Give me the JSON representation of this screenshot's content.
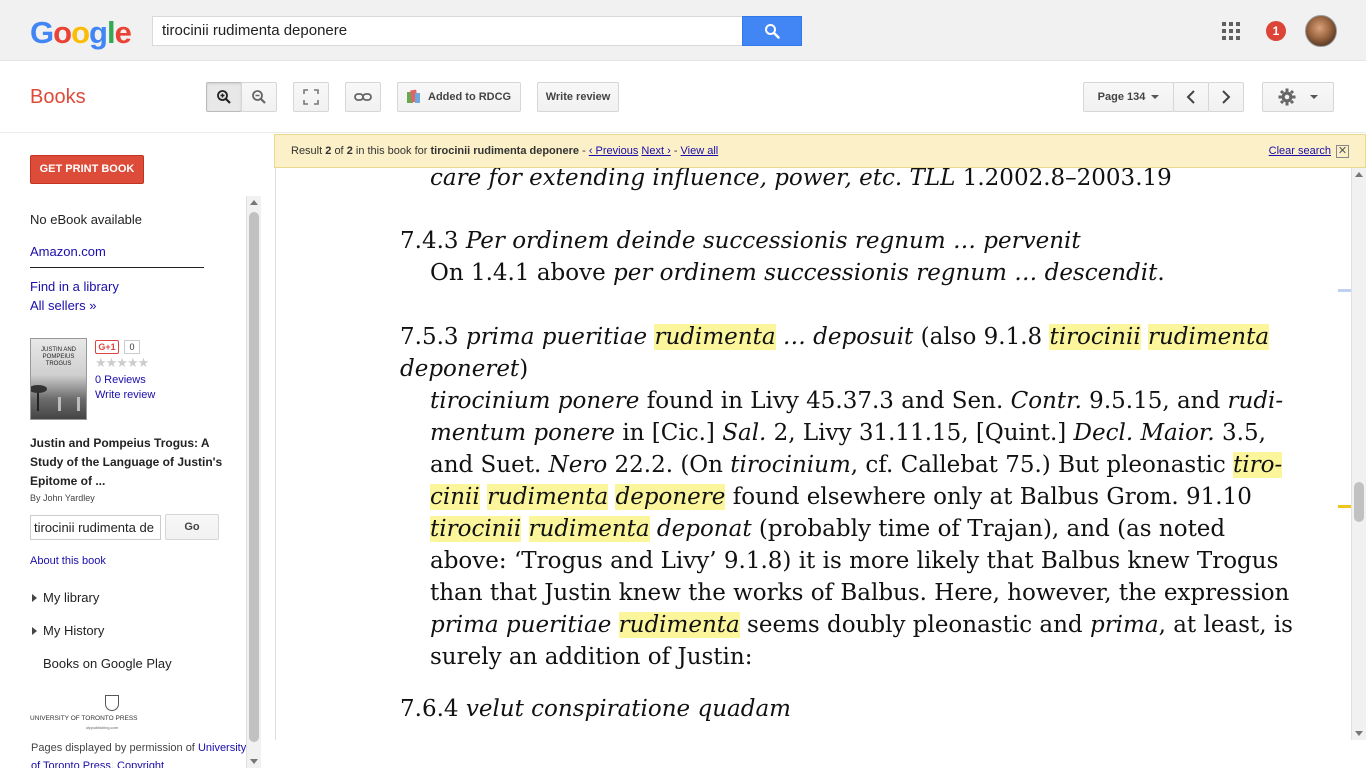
{
  "header": {
    "logo_letters": [
      {
        "ch": "G",
        "color": "#4285f4"
      },
      {
        "ch": "o",
        "color": "#ea4335"
      },
      {
        "ch": "o",
        "color": "#fbbc05"
      },
      {
        "ch": "g",
        "color": "#4285f4"
      },
      {
        "ch": "l",
        "color": "#34a853"
      },
      {
        "ch": "e",
        "color": "#ea4335"
      }
    ],
    "search_value": "tirocinii rudimenta deponere",
    "notification_count": "1"
  },
  "toolbar": {
    "section_title": "Books",
    "added_label": "Added to RDCG",
    "write_review_label": "Write review",
    "page_label": "Page 134"
  },
  "resultbar": {
    "result_prefix": "Result",
    "result_index": "2",
    "of_label": "of",
    "result_total": "2",
    "in_book_text": "in this book for",
    "query": "tirocinii rudimenta deponere",
    "previous_label": "‹ Previous",
    "next_label": "Next ›",
    "view_all_label": "View all",
    "clear_search_label": "Clear search"
  },
  "sidebar": {
    "print_button": "GET PRINT BOOK",
    "no_ebook": "No eBook available",
    "amazon": "Amazon.com",
    "find_library": "Find in a library",
    "all_sellers": "All sellers »",
    "cover_title": "JUSTIN AND POMPEIUS TROGUS",
    "gplus_label": "G+1",
    "gplus_count": "0",
    "reviews_label": "0 Reviews",
    "write_review_label": "Write review",
    "book_title": "Justin and Pompeius Trogus: A Study of the Language of Justin's Epitome of ...",
    "author": "By John Yardley",
    "search_value": "tirocinii rudimenta de",
    "go_label": "Go",
    "about_book": "About this book",
    "my_library": "My library",
    "my_history": "My History",
    "books_on_play": "Books on Google Play",
    "publisher_logo_name": "UNIVERSITY OF TORONTO PRESS",
    "publisher_logo_sub": "utppublishing.com",
    "permission_prefix": "Pages displayed by permission of",
    "permission_link": "University of Toronto Press",
    "copyright_label": "Copyright"
  },
  "page": {
    "lines": [
      {
        "parts": [
          {
            "t": "care for extending influence, power, etc. ",
            "i": true
          },
          {
            "t": "TLL",
            "i": true
          },
          {
            "t": " 1.2002.8–2003.19"
          }
        ]
      },
      {
        "parts": [
          {
            "t": "7.4.3 "
          },
          {
            "t": "Per ordinem deinde successionis regnum … pervenit",
            "i": true
          }
        ]
      },
      {
        "parts": [
          {
            "t": "On 1.4.1 above "
          },
          {
            "t": "per ordinem successionis regnum … descendit",
            "i": true
          },
          {
            "t": "."
          }
        ]
      },
      {
        "parts": [
          {
            "t": "7.5.3 "
          },
          {
            "t": "prima pueritiae ",
            "i": true
          },
          {
            "t": "rudimenta",
            "i": true,
            "h": true
          },
          {
            "t": " … deposuit",
            "i": true
          },
          {
            "t": " (also 9.1.8 "
          },
          {
            "t": "tirocinii",
            "i": true,
            "h": true
          },
          {
            "t": " "
          },
          {
            "t": "rudimenta",
            "i": true,
            "h": true
          }
        ]
      },
      {
        "parts": [
          {
            "t": "deponeret",
            "i": true
          },
          {
            "t": ")"
          }
        ]
      },
      {
        "parts": [
          {
            "t": "tirocinium ponere",
            "i": true
          },
          {
            "t": " found in Livy 45.37.3 and Sen. "
          },
          {
            "t": "Contr.",
            "i": true
          },
          {
            "t": " 9.5.15, and "
          },
          {
            "t": "rudi-",
            "i": true
          }
        ]
      },
      {
        "parts": [
          {
            "t": "mentum ponere",
            "i": true
          },
          {
            "t": " in [Cic.] "
          },
          {
            "t": "Sal.",
            "i": true
          },
          {
            "t": " 2, Livy 31.11.15, [Quint.] "
          },
          {
            "t": "Decl. Maior.",
            "i": true
          },
          {
            "t": " 3.5,"
          }
        ]
      },
      {
        "parts": [
          {
            "t": "and Suet. "
          },
          {
            "t": "Nero",
            "i": true
          },
          {
            "t": " 22.2. (On "
          },
          {
            "t": "tirocinium",
            "i": true
          },
          {
            "t": ", cf. Callebat 75.) But pleonastic "
          },
          {
            "t": "tiro-",
            "i": true,
            "h": true
          }
        ]
      },
      {
        "parts": [
          {
            "t": "cinii",
            "i": true,
            "h": true
          },
          {
            "t": " "
          },
          {
            "t": "rudimenta",
            "i": true,
            "h": true
          },
          {
            "t": " "
          },
          {
            "t": "deponere",
            "i": true,
            "h": true
          },
          {
            "t": " found elsewhere only at Balbus Grom. 91.10"
          }
        ]
      },
      {
        "parts": [
          {
            "t": "tirocinii",
            "i": true,
            "h": true
          },
          {
            "t": " "
          },
          {
            "t": "rudimenta",
            "i": true,
            "h": true
          },
          {
            "t": " deponat",
            "i": true
          },
          {
            "t": " (probably time of Trajan), and (as noted"
          }
        ]
      },
      {
        "parts": [
          {
            "t": "above: ‘Trogus and Livy’ 9.1.8) it is more likely that Balbus knew Trogus"
          }
        ]
      },
      {
        "parts": [
          {
            "t": "than that Justin knew the works of Balbus. Here, however, the expression"
          }
        ]
      },
      {
        "parts": [
          {
            "t": "prima pueritiae",
            "i": true
          },
          {
            "t": " "
          },
          {
            "t": "rudimenta",
            "i": true,
            "h": true
          },
          {
            "t": " seems doubly pleonastic and "
          },
          {
            "t": "prima",
            "i": true
          },
          {
            "t": ", at least, is"
          }
        ]
      },
      {
        "parts": [
          {
            "t": "surely an addition of Justin:"
          }
        ]
      },
      {
        "parts": [
          {
            "t": "7.6.4 "
          },
          {
            "t": "velut conspiratione quadam",
            "i": true
          }
        ]
      }
    ]
  }
}
